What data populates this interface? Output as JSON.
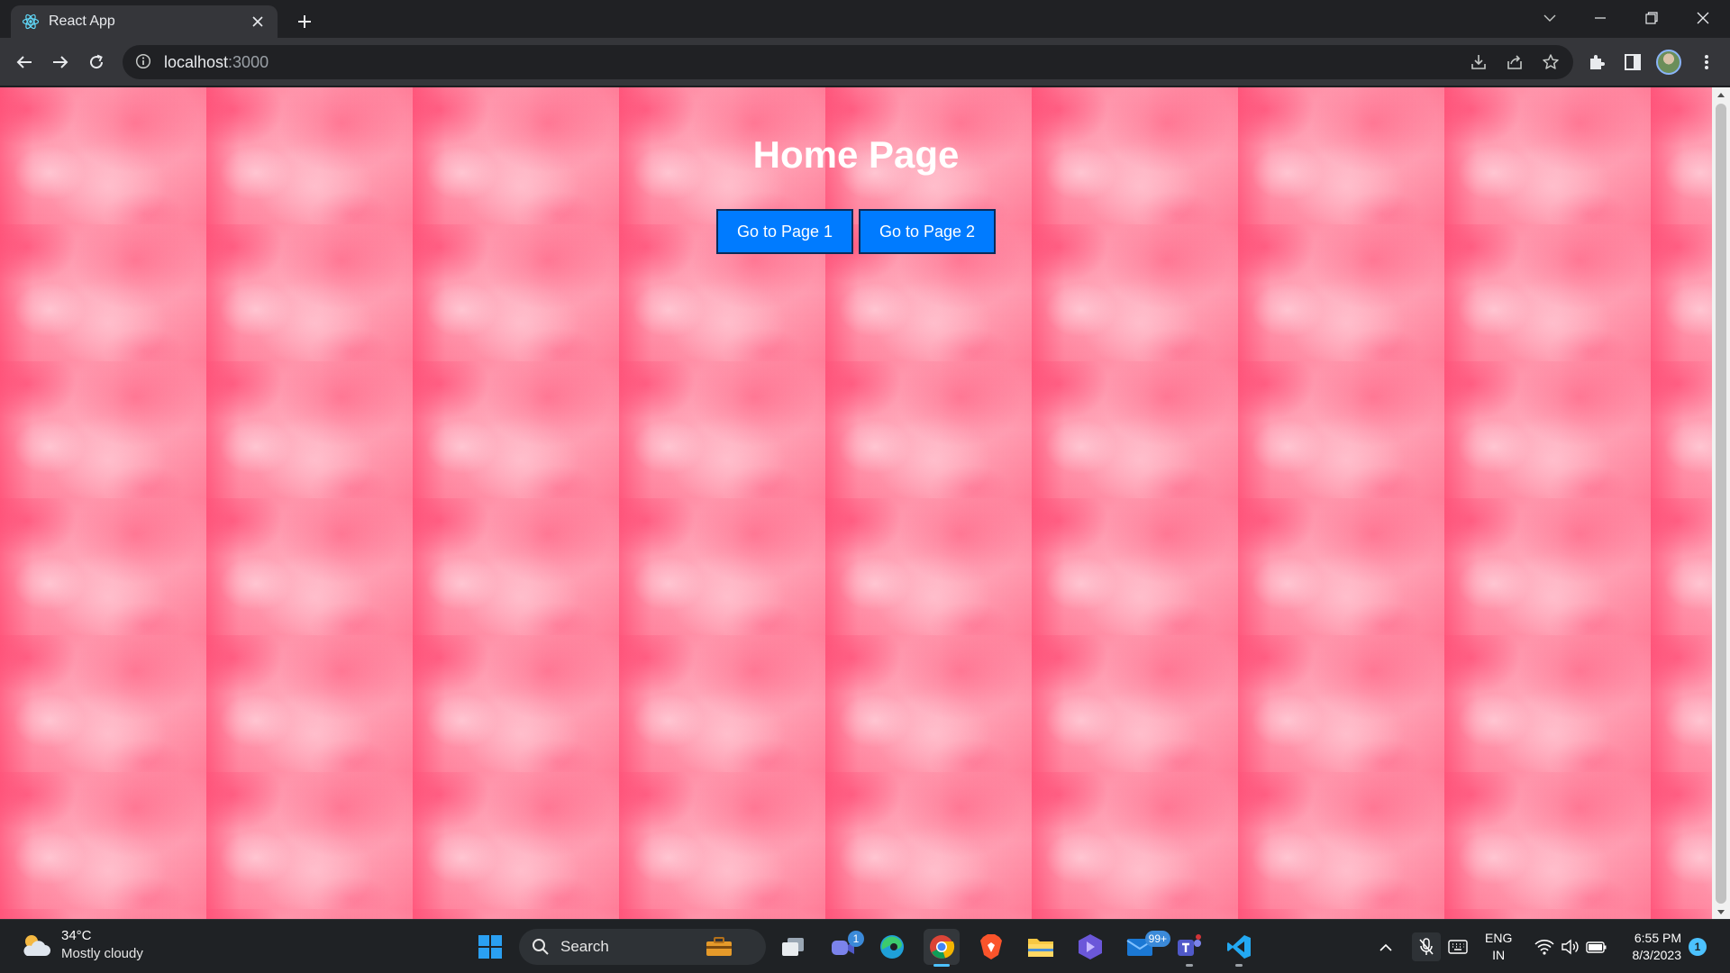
{
  "browser": {
    "tab_title": "React App",
    "url_host": "localhost",
    "url_port": ":3000"
  },
  "page": {
    "heading": "Home Page",
    "buttons": [
      {
        "label": "Go to Page 1"
      },
      {
        "label": "Go to Page 2"
      }
    ],
    "background_color": "#ff8fa6",
    "button_color": "#007bff"
  },
  "taskbar": {
    "weather": {
      "temp": "34°C",
      "desc": "Mostly cloudy"
    },
    "search_label": "Search",
    "badges": {
      "teams_meet": "1",
      "mail": "99+"
    },
    "tray": {
      "lang_line1": "ENG",
      "lang_line2": "IN"
    },
    "clock": {
      "time": "6:55 PM",
      "date": "8/3/2023"
    },
    "notification_count": "1"
  }
}
